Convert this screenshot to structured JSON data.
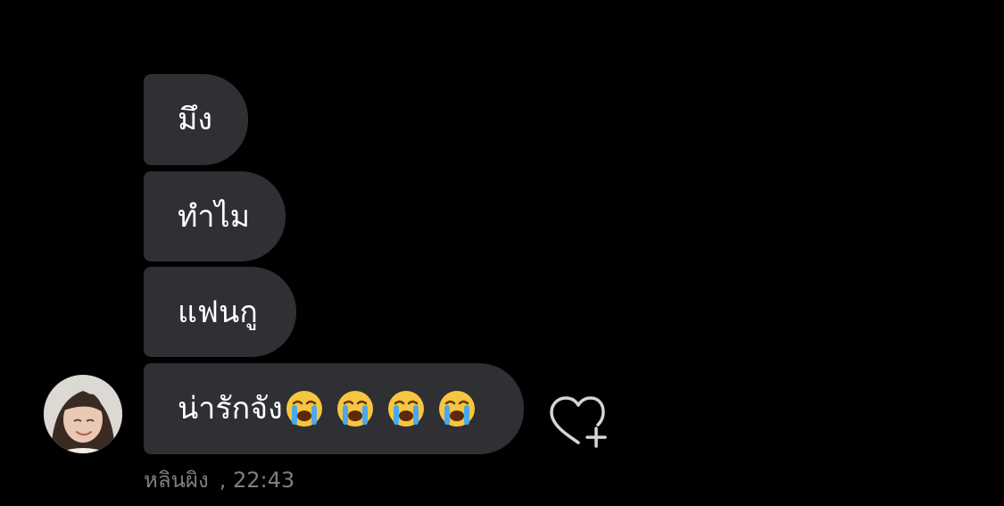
{
  "messages": [
    {
      "text": "มึง"
    },
    {
      "text": "ทำไม"
    },
    {
      "text": "แฟนกู"
    },
    {
      "text": "น่ารักจัง",
      "emojis": [
        "loudly-crying-face",
        "loudly-crying-face",
        "loudly-crying-face",
        "loudly-crying-face"
      ]
    }
  ],
  "sender": {
    "name": "หลินผิง",
    "time": "22:43",
    "separator": ","
  },
  "icons": {
    "react": "heart-plus-icon",
    "avatar": "user-avatar"
  },
  "colors": {
    "background": "#000000",
    "bubble": "#2f3033",
    "text": "#ffffff",
    "meta": "#7d7e82"
  }
}
